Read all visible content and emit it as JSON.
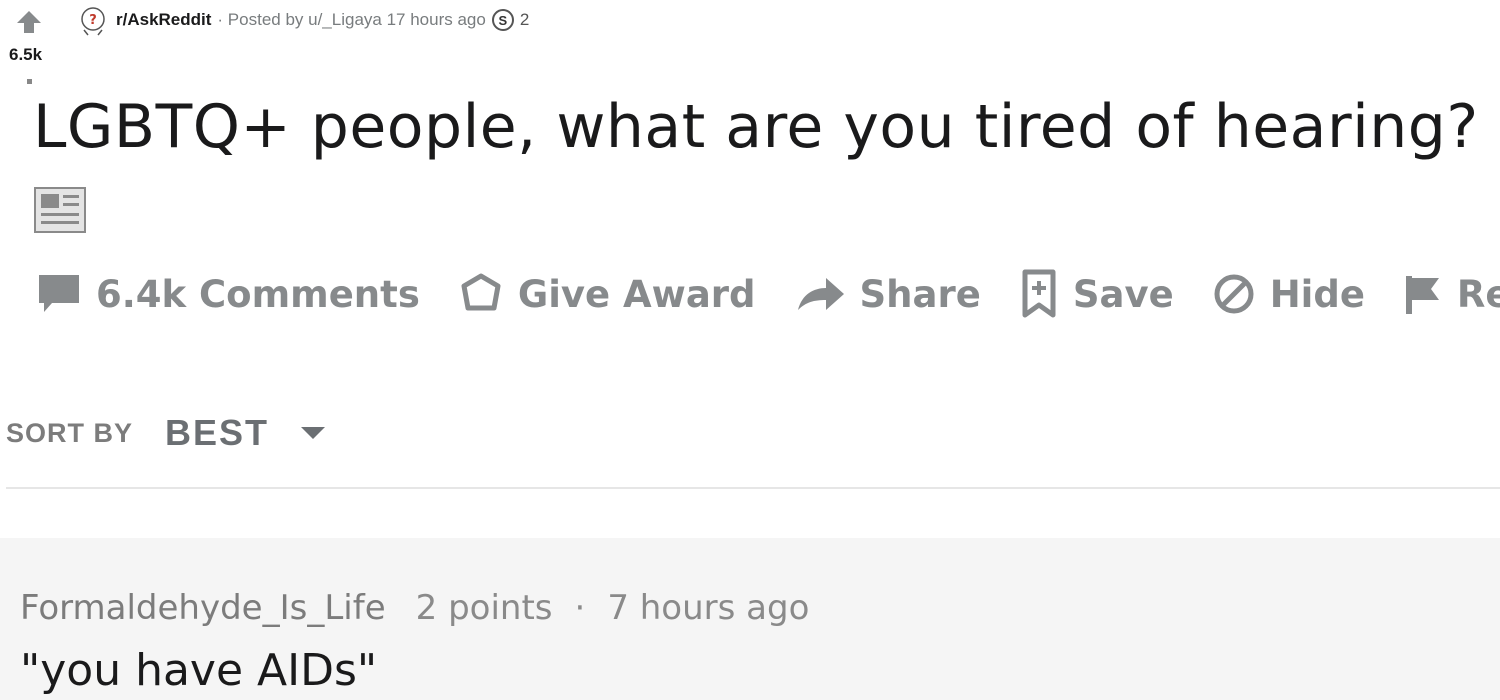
{
  "vote": {
    "score": "6.5k"
  },
  "meta": {
    "subreddit": "r/AskReddit",
    "posted_by": "· Posted by u/_Ligaya 17 hours ago",
    "award_symbol": "S",
    "award_count": "2"
  },
  "post": {
    "title": "LGBTQ+ people, what are you tired of hearing?"
  },
  "actions": {
    "comments": "6.4k Comments",
    "give_award": "Give Award",
    "share": "Share",
    "save": "Save",
    "hide": "Hide",
    "report": "Re"
  },
  "sort": {
    "label": "SORT BY",
    "value": "BEST"
  },
  "comment": {
    "author": "Formaldehyde_Is_Life",
    "points": "2 points",
    "separator": "·",
    "time": "7 hours ago",
    "body": "\"you have AIDs\""
  },
  "colors": {
    "muted": "#878a8c",
    "text": "#1a1a1b",
    "comment_bg": "#f5f5f5"
  }
}
